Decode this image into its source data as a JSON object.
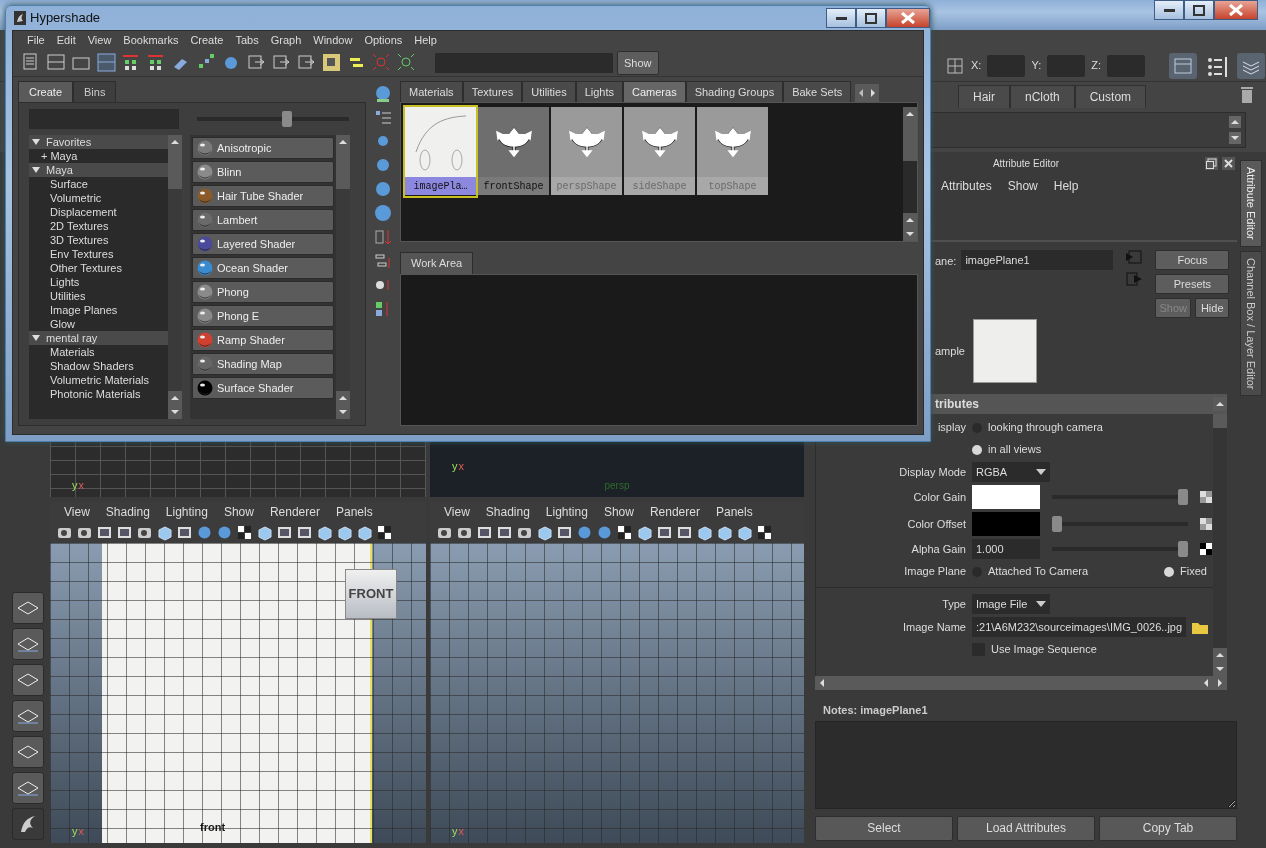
{
  "status_line": {
    "fields": [
      {
        "label": "X:"
      },
      {
        "label": "Y:"
      },
      {
        "label": "Z:"
      }
    ]
  },
  "shelf": {
    "tabs": [
      {
        "label": "Hair"
      },
      {
        "label": "nCloth"
      },
      {
        "label": "Custom"
      }
    ]
  },
  "hypershade": {
    "title": "Hypershade",
    "menu": [
      "File",
      "Edit",
      "View",
      "Bookmarks",
      "Create",
      "Tabs",
      "Graph",
      "Window",
      "Options",
      "Help"
    ],
    "show_button": "Show",
    "create_tabs": [
      {
        "label": "Create",
        "selected": true
      },
      {
        "label": "Bins",
        "selected": false
      }
    ],
    "size_slider": {
      "level": 0.6
    },
    "tree": [
      {
        "label": "Favorites",
        "expanded": true,
        "children": [
          {
            "label": "Maya",
            "marker": "+"
          }
        ]
      },
      {
        "label": "Maya",
        "expanded": true,
        "children": [
          {
            "label": "Surface"
          },
          {
            "label": "Volumetric"
          },
          {
            "label": "Displacement"
          },
          {
            "label": "2D Textures"
          },
          {
            "label": "3D Textures"
          },
          {
            "label": "Env Textures"
          },
          {
            "label": "Other Textures"
          },
          {
            "label": "Lights"
          },
          {
            "label": "Utilities"
          },
          {
            "label": "Image Planes"
          },
          {
            "label": "Glow"
          }
        ]
      },
      {
        "label": "mental ray",
        "expanded": true,
        "children": [
          {
            "label": "Materials"
          },
          {
            "label": "Shadow Shaders"
          },
          {
            "label": "Volumetric Materials"
          },
          {
            "label": "Photonic Materials"
          }
        ]
      }
    ],
    "nodes": [
      {
        "label": "Anisotropic",
        "color": "#7a7a7a"
      },
      {
        "label": "Blinn",
        "color": "#8a8a8a"
      },
      {
        "label": "Hair Tube Shader",
        "color": "#8a5a2a"
      },
      {
        "label": "Lambert",
        "color": "#6a6a6a"
      },
      {
        "label": "Layered Shader",
        "color": "#4a4a9a"
      },
      {
        "label": "Ocean Shader",
        "color": "#3a8ad0"
      },
      {
        "label": "Phong",
        "color": "#8a8a8a"
      },
      {
        "label": "Phong E",
        "color": "#8a8a8a"
      },
      {
        "label": "Ramp Shader",
        "color": "#d04030"
      },
      {
        "label": "Shading Map",
        "color": "#666666"
      },
      {
        "label": "Surface Shader",
        "color": "#000000"
      }
    ],
    "tabs": [
      {
        "label": "Materials",
        "selected": false
      },
      {
        "label": "Textures",
        "selected": false
      },
      {
        "label": "Utilities",
        "selected": false
      },
      {
        "label": "Lights",
        "selected": false
      },
      {
        "label": "Cameras",
        "selected": true
      },
      {
        "label": "Shading Groups",
        "selected": false
      },
      {
        "label": "Bake Sets",
        "selected": false
      }
    ],
    "swatches": [
      {
        "label": "imagePla…",
        "kind": "image",
        "selected": true,
        "dimmed": false
      },
      {
        "label": "frontShape",
        "kind": "camera",
        "selected": false,
        "dimmed": false
      },
      {
        "label": "perspShape",
        "kind": "camera",
        "selected": false,
        "dimmed": true
      },
      {
        "label": "sideShape",
        "kind": "camera",
        "selected": false,
        "dimmed": true
      },
      {
        "label": "topShape",
        "kind": "camera",
        "selected": false,
        "dimmed": true
      }
    ],
    "work_area_tab": "Work Area"
  },
  "viewports": [
    {
      "kind": "partial",
      "axis": [
        "y",
        "x"
      ]
    },
    {
      "kind": "partial",
      "axis": [
        "y",
        "x"
      ],
      "camera_label": "persp"
    },
    {
      "kind": "full",
      "menu": [
        "View",
        "Shading",
        "Lighting",
        "Show",
        "Renderer",
        "Panels"
      ],
      "axis": [
        "y",
        "x"
      ],
      "viewcube": "FRONT",
      "camera_label": "front",
      "image_plane": true
    },
    {
      "kind": "full",
      "menu": [
        "View",
        "Shading",
        "Lighting",
        "Show",
        "Renderer",
        "Panels"
      ],
      "axis": [
        "y",
        "x"
      ]
    }
  ],
  "attribute_editor": {
    "title": "Attribute Editor",
    "menu": [
      "Attributes",
      "Show",
      "Help"
    ],
    "name_label": "ane:",
    "name_value": "imagePlane1",
    "buttons": [
      {
        "label": "Focus",
        "disabled": false
      },
      {
        "label": "Presets",
        "disabled": false
      },
      {
        "label": "Show",
        "disabled": true
      },
      {
        "label": "Hide",
        "disabled": false
      }
    ],
    "sample_label": "ample",
    "section_title": "tributes",
    "rows": [
      {
        "kind": "radio",
        "label": "isplay",
        "options": [
          {
            "label": "looking through camera",
            "selected": false
          }
        ]
      },
      {
        "kind": "radio",
        "options": [
          {
            "label": "in all views",
            "selected": true
          }
        ]
      },
      {
        "kind": "dropdown",
        "label": "Display Mode",
        "value": "RGBA"
      },
      {
        "kind": "color",
        "label": "Color Gain",
        "color": "#ffffff",
        "level": 1.0
      },
      {
        "kind": "color",
        "label": "Color Offset",
        "color": "#000000",
        "level": 0.0
      },
      {
        "kind": "number",
        "label": "Alpha Gain",
        "value": "1.000",
        "level": 1.0
      },
      {
        "kind": "radio",
        "label": "Image Plane",
        "options": [
          {
            "label": "Attached To Camera",
            "selected": false
          },
          {
            "label": "Fixed",
            "selected": true
          }
        ]
      },
      {
        "kind": "separator"
      },
      {
        "kind": "dropdown",
        "label": "Type",
        "value": "Image File"
      },
      {
        "kind": "file",
        "label": "Image Name",
        "value": ":21\\A6M232\\sourceimages\\IMG_0026..jpg"
      },
      {
        "kind": "checkbox",
        "label": "Use Image Sequence",
        "checked": false
      }
    ],
    "notes_label": "Notes:  imagePlane1",
    "bottom_buttons": [
      "Select",
      "Load Attributes",
      "Copy Tab"
    ]
  },
  "side_tabs": [
    {
      "label": "Attribute Editor",
      "selected": true
    },
    {
      "label": "Channel Box / Layer Editor",
      "selected": false
    }
  ]
}
